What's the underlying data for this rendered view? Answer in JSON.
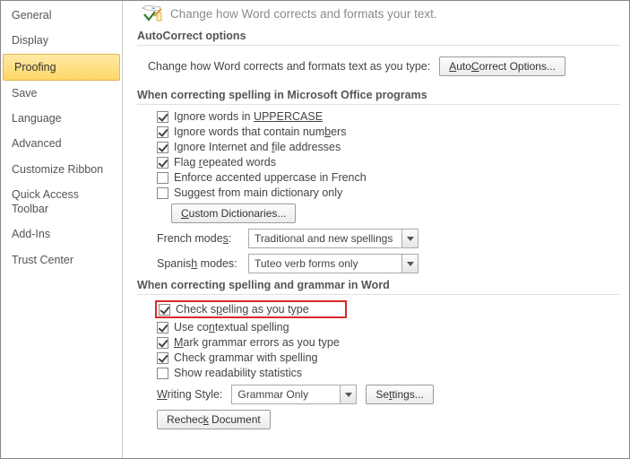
{
  "header": {
    "text": "Change how Word corrects and formats your text."
  },
  "sidebar": {
    "items": [
      "General",
      "Display",
      "Proofing",
      "Save",
      "Language",
      "Advanced",
      "Customize Ribbon",
      "Quick Access Toolbar",
      "Add-Ins",
      "Trust Center"
    ],
    "selected_index": 2
  },
  "sections": {
    "autocorrect": {
      "title": "AutoCorrect options",
      "text": "Change how Word corrects and formats text as you type:",
      "button": "AutoCorrect Options..."
    },
    "office": {
      "title": "When correcting spelling in Microsoft Office programs",
      "ignoreUpper": {
        "pre": "Ignore words in ",
        "accent": "UPPERCASE"
      },
      "ignoreNumbers": {
        "pre": "Ignore words that contain num",
        "u": "b",
        "post": "ers"
      },
      "ignoreUrls": {
        "pre": "Ignore Internet and ",
        "u": "f",
        "post": "ile addresses"
      },
      "flagRepeat": {
        "pre": "Flag ",
        "u": "r",
        "post": "epeated words"
      },
      "enforceFrench": "Enforce accented uppercase in French",
      "suggestMain": "Suggest from main dictionary only",
      "customDictBtn": {
        "u": "C",
        "post": "ustom Dictionaries..."
      },
      "frenchLabel": {
        "pre": "French mode",
        "u": "s",
        "post": ":"
      },
      "frenchValue": "Traditional and new spellings",
      "spanishLabel": {
        "pre": "Spanis",
        "u": "h",
        "post": " modes:"
      },
      "spanishValue": "Tuteo verb forms only"
    },
    "word": {
      "title": "When correcting spelling and grammar in Word",
      "checkSpelling": {
        "pre": "Check s",
        "u": "p",
        "post": "elling as you type"
      },
      "contextual": {
        "pre": "Use co",
        "u": "n",
        "post": "textual spelling"
      },
      "markGrammar": {
        "u": "M",
        "post": "ark grammar errors as you type"
      },
      "checkGrammarWith": {
        "pre": "Check grammar with spelling"
      },
      "readability": {
        "pre": "Show readability statistics"
      },
      "writingStyleLabel": {
        "u": "W",
        "post": "riting Style:"
      },
      "writingStyleValue": "Grammar Only",
      "settingsBtn": {
        "pre": "Se",
        "u": "t",
        "post": "tings..."
      },
      "recheckBtn": {
        "pre": "Rechec",
        "u": "k",
        "post": " Document"
      }
    }
  }
}
